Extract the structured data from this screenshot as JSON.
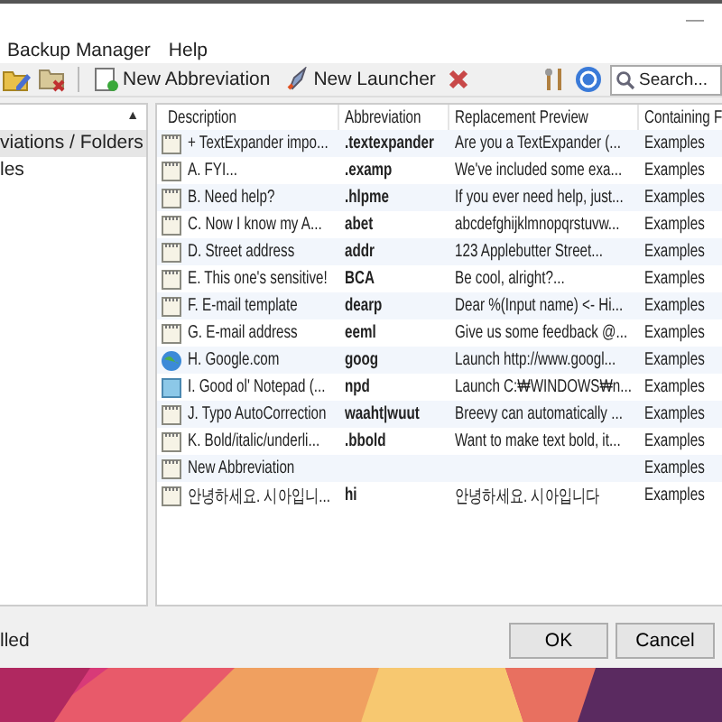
{
  "window": {
    "minimize": "—"
  },
  "menu": [
    "Backup Manager",
    "Help"
  ],
  "toolbar": {
    "new_abbreviation": "New Abbreviation",
    "new_launcher": "New Launcher",
    "search": {
      "placeholder": "Search..."
    }
  },
  "sidebar": {
    "scroll_arrow": "▲",
    "items": [
      {
        "label": "viations / Folders",
        "selected": true
      },
      {
        "label": "les",
        "selected": false
      }
    ]
  },
  "table": {
    "columns": [
      "Description",
      "Abbreviation",
      "Replacement Preview",
      "Containing F"
    ],
    "rows": [
      {
        "kind": "note",
        "cells": [
          "+ TextExpander impo...",
          ".textexpander",
          "Are you a TextExpander (...",
          "Examples"
        ]
      },
      {
        "kind": "note",
        "cells": [
          "A. FYI...",
          ".examp",
          "We've included some exa...",
          "Examples"
        ]
      },
      {
        "kind": "note",
        "cells": [
          "B. Need help?",
          ".hlpme",
          "If you ever need help, just...",
          "Examples"
        ]
      },
      {
        "kind": "note",
        "cells": [
          "C. Now I know my A...",
          "abet",
          "abcdefghijklmnopqrstuvw...",
          "Examples"
        ]
      },
      {
        "kind": "note",
        "cells": [
          "D. Street address",
          "addr",
          "123 Applebutter Street...",
          "Examples"
        ]
      },
      {
        "kind": "note",
        "cells": [
          "E. This one's sensitive!",
          "BCA",
          "Be cool, alright?...",
          "Examples"
        ]
      },
      {
        "kind": "note",
        "cells": [
          "F. E-mail template",
          "dearp",
          "Dear %(Input name) <- Hi...",
          "Examples"
        ]
      },
      {
        "kind": "note",
        "cells": [
          "G. E-mail address",
          "eeml",
          "Give us some feedback @...",
          "Examples"
        ]
      },
      {
        "kind": "web",
        "cells": [
          "H. Google.com",
          "goog",
          "Launch http://www.googl...",
          "Examples"
        ]
      },
      {
        "kind": "app",
        "cells": [
          "I. Good ol' Notepad (...",
          "npd",
          "Launch C:₩WINDOWS₩n...",
          "Examples"
        ]
      },
      {
        "kind": "note",
        "cells": [
          "J. Typo AutoCorrection",
          "waaht|wuut",
          "Breevy can automatically ...",
          "Examples"
        ]
      },
      {
        "kind": "note",
        "cells": [
          "K. Bold/italic/underli...",
          ".bbold",
          "Want to make text bold, it...",
          "Examples"
        ]
      },
      {
        "kind": "note",
        "cells": [
          "New Abbreviation",
          "",
          "",
          "Examples"
        ]
      },
      {
        "kind": "note",
        "cells": [
          "안녕하세요. 시아입니...",
          "hi",
          "안녕하세요. 시아입니다",
          "Examples"
        ]
      }
    ]
  },
  "status_bar": {
    "text": "lled",
    "buttons": [
      "OK",
      "Cancel"
    ]
  }
}
